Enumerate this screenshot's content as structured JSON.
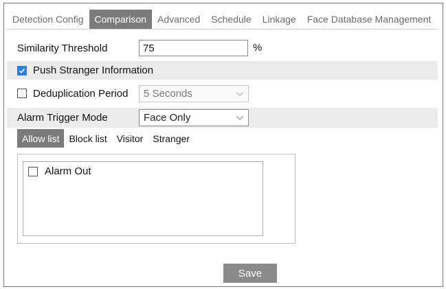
{
  "tabs": [
    {
      "label": "Detection Config",
      "active": false
    },
    {
      "label": "Comparison",
      "active": true
    },
    {
      "label": "Advanced",
      "active": false
    },
    {
      "label": "Schedule",
      "active": false
    },
    {
      "label": "Linkage",
      "active": false
    },
    {
      "label": "Face Database Management",
      "active": false
    }
  ],
  "similarity": {
    "label": "Similarity Threshold",
    "value": "75",
    "unit": "%"
  },
  "push_stranger": {
    "label": "Push Stranger Information",
    "checked": true
  },
  "dedup": {
    "label": "Deduplication Period",
    "checked": false,
    "value": "5 Seconds",
    "disabled": true
  },
  "alarm_trigger": {
    "label": "Alarm Trigger Mode",
    "value": "Face Only"
  },
  "subtabs": [
    {
      "label": "Allow list",
      "active": true
    },
    {
      "label": "Block list",
      "active": false
    },
    {
      "label": "Visitor",
      "active": false
    },
    {
      "label": "Stranger",
      "active": false
    }
  ],
  "alarm_out": {
    "label": "Alarm Out",
    "checked": false
  },
  "save_label": "Save",
  "colors": {
    "accent": "#2f7de1",
    "tab_active": "#7b7b7b",
    "row_shade": "#ebebeb",
    "button": "#8a8a8a"
  }
}
